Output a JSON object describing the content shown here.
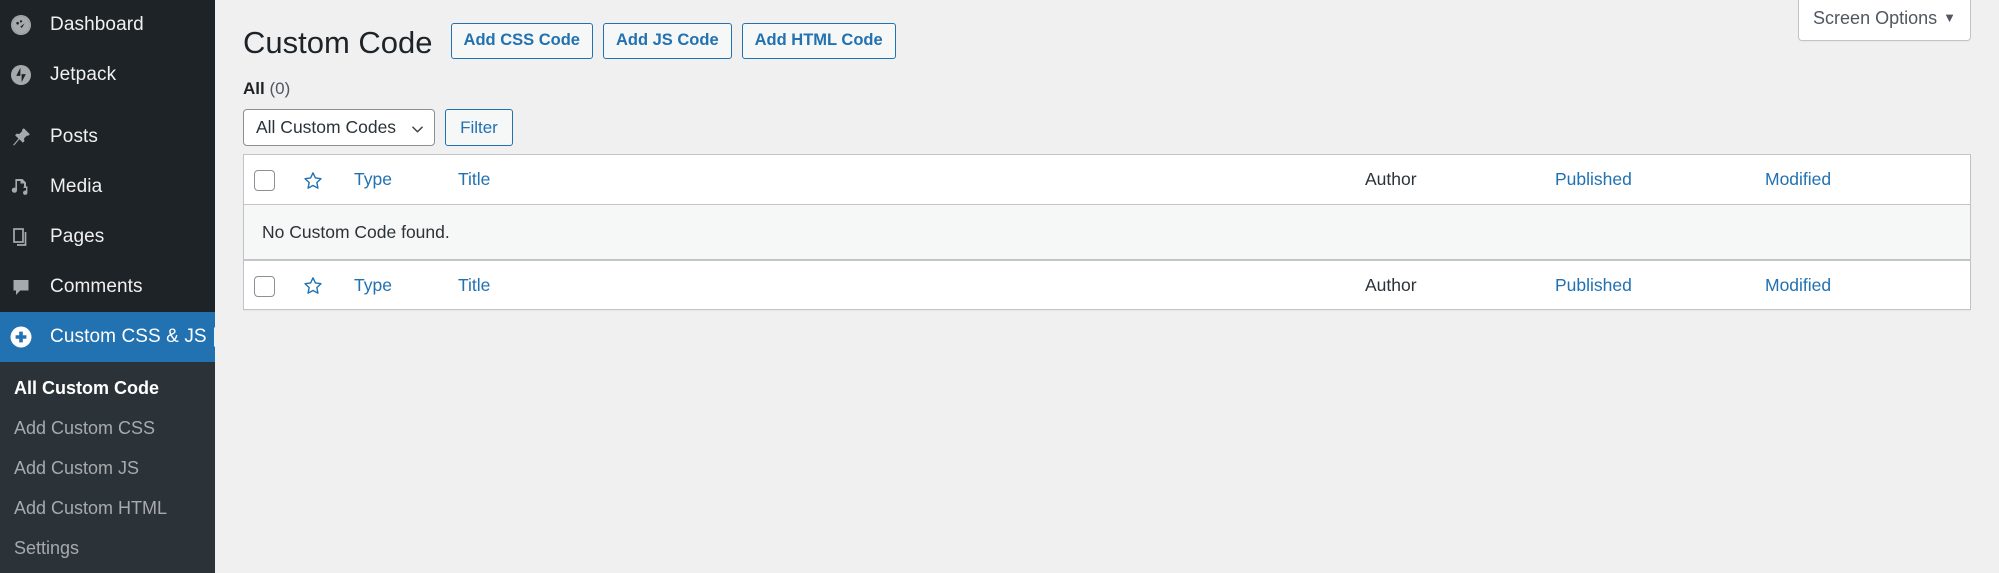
{
  "colors": {
    "sidebar_bg": "#1d2327",
    "submenu_bg": "#2c3338",
    "accent_blue": "#2271b1",
    "page_bg": "#f0f0f1",
    "link_blue": "#2271b1"
  },
  "sidebar": {
    "items": [
      {
        "label": "Dashboard",
        "icon": "dashboard-icon",
        "current": false
      },
      {
        "label": "Jetpack",
        "icon": "jetpack-icon",
        "current": false
      },
      {
        "label": "Posts",
        "icon": "pin-icon",
        "current": false
      },
      {
        "label": "Media",
        "icon": "media-icon",
        "current": false
      },
      {
        "label": "Pages",
        "icon": "pages-icon",
        "current": false
      },
      {
        "label": "Comments",
        "icon": "comment-icon",
        "current": false
      },
      {
        "label": "Custom CSS & JS",
        "icon": "plus-circle-icon",
        "current": true
      }
    ],
    "submenu": [
      {
        "label": "All Custom Code",
        "current": true
      },
      {
        "label": "Add Custom CSS",
        "current": false
      },
      {
        "label": "Add Custom JS",
        "current": false
      },
      {
        "label": "Add Custom HTML",
        "current": false
      },
      {
        "label": "Settings",
        "current": false
      }
    ]
  },
  "screen_meta": {
    "screen_options_label": "Screen Options",
    "caret": "▼"
  },
  "header": {
    "title": "Custom Code",
    "actions": [
      {
        "label": "Add CSS Code"
      },
      {
        "label": "Add JS Code"
      },
      {
        "label": "Add HTML Code"
      }
    ]
  },
  "views": {
    "all_label": "All",
    "all_count": "(0)"
  },
  "tablenav": {
    "filter_select_value": "All Custom Codes",
    "filter_select_options": [
      "All Custom Codes"
    ],
    "filter_button_label": "Filter"
  },
  "table": {
    "columns": {
      "type": "Type",
      "title": "Title",
      "author": "Author",
      "published": "Published",
      "modified": "Modified"
    },
    "rows": [],
    "empty_message": "No Custom Code found."
  }
}
